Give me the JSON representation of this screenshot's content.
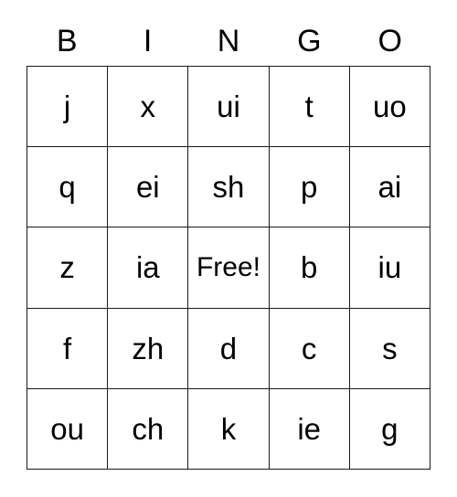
{
  "card": {
    "headers": [
      "B",
      "I",
      "N",
      "G",
      "O"
    ],
    "rows": [
      [
        "j",
        "x",
        "ui",
        "t",
        "uo"
      ],
      [
        "q",
        "ei",
        "sh",
        "p",
        "ai"
      ],
      [
        "z",
        "ia",
        "Free!",
        "b",
        "iu"
      ],
      [
        "f",
        "zh",
        "d",
        "c",
        "s"
      ],
      [
        "ou",
        "ch",
        "k",
        "ie",
        "g"
      ]
    ],
    "free_space": "Free!",
    "colors": {
      "background": "#ffffff",
      "border": "#1a1a1a",
      "text": "#000000"
    }
  }
}
